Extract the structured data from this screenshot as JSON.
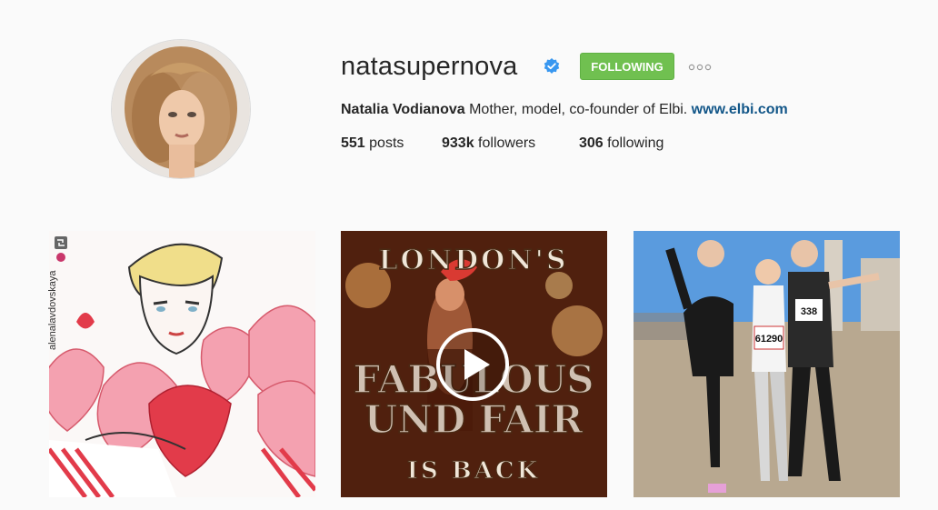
{
  "profile": {
    "username": "natasupernova",
    "follow_label": "FOLLOWING",
    "full_name": "Natalia Vodianova",
    "bio": "Mother, model, co-founder of Elbi.",
    "website": "www.elbi.com",
    "posts_count": "551",
    "posts_label": "posts",
    "followers_count": "933k",
    "followers_label": "followers",
    "following_count": "306",
    "following_label": "following"
  },
  "posts": [
    {
      "repost_user": "alenalavdovskaya"
    },
    {
      "line1": "LONDON'S",
      "line2": "FABULOUS",
      "line3": "UND FAIR",
      "line4": "IS BACK"
    },
    {
      "bib1": "61290",
      "bib2": "338"
    }
  ],
  "colors": {
    "accent_green": "#70c050",
    "link_blue": "#125688",
    "verified_blue": "#3897f0"
  }
}
